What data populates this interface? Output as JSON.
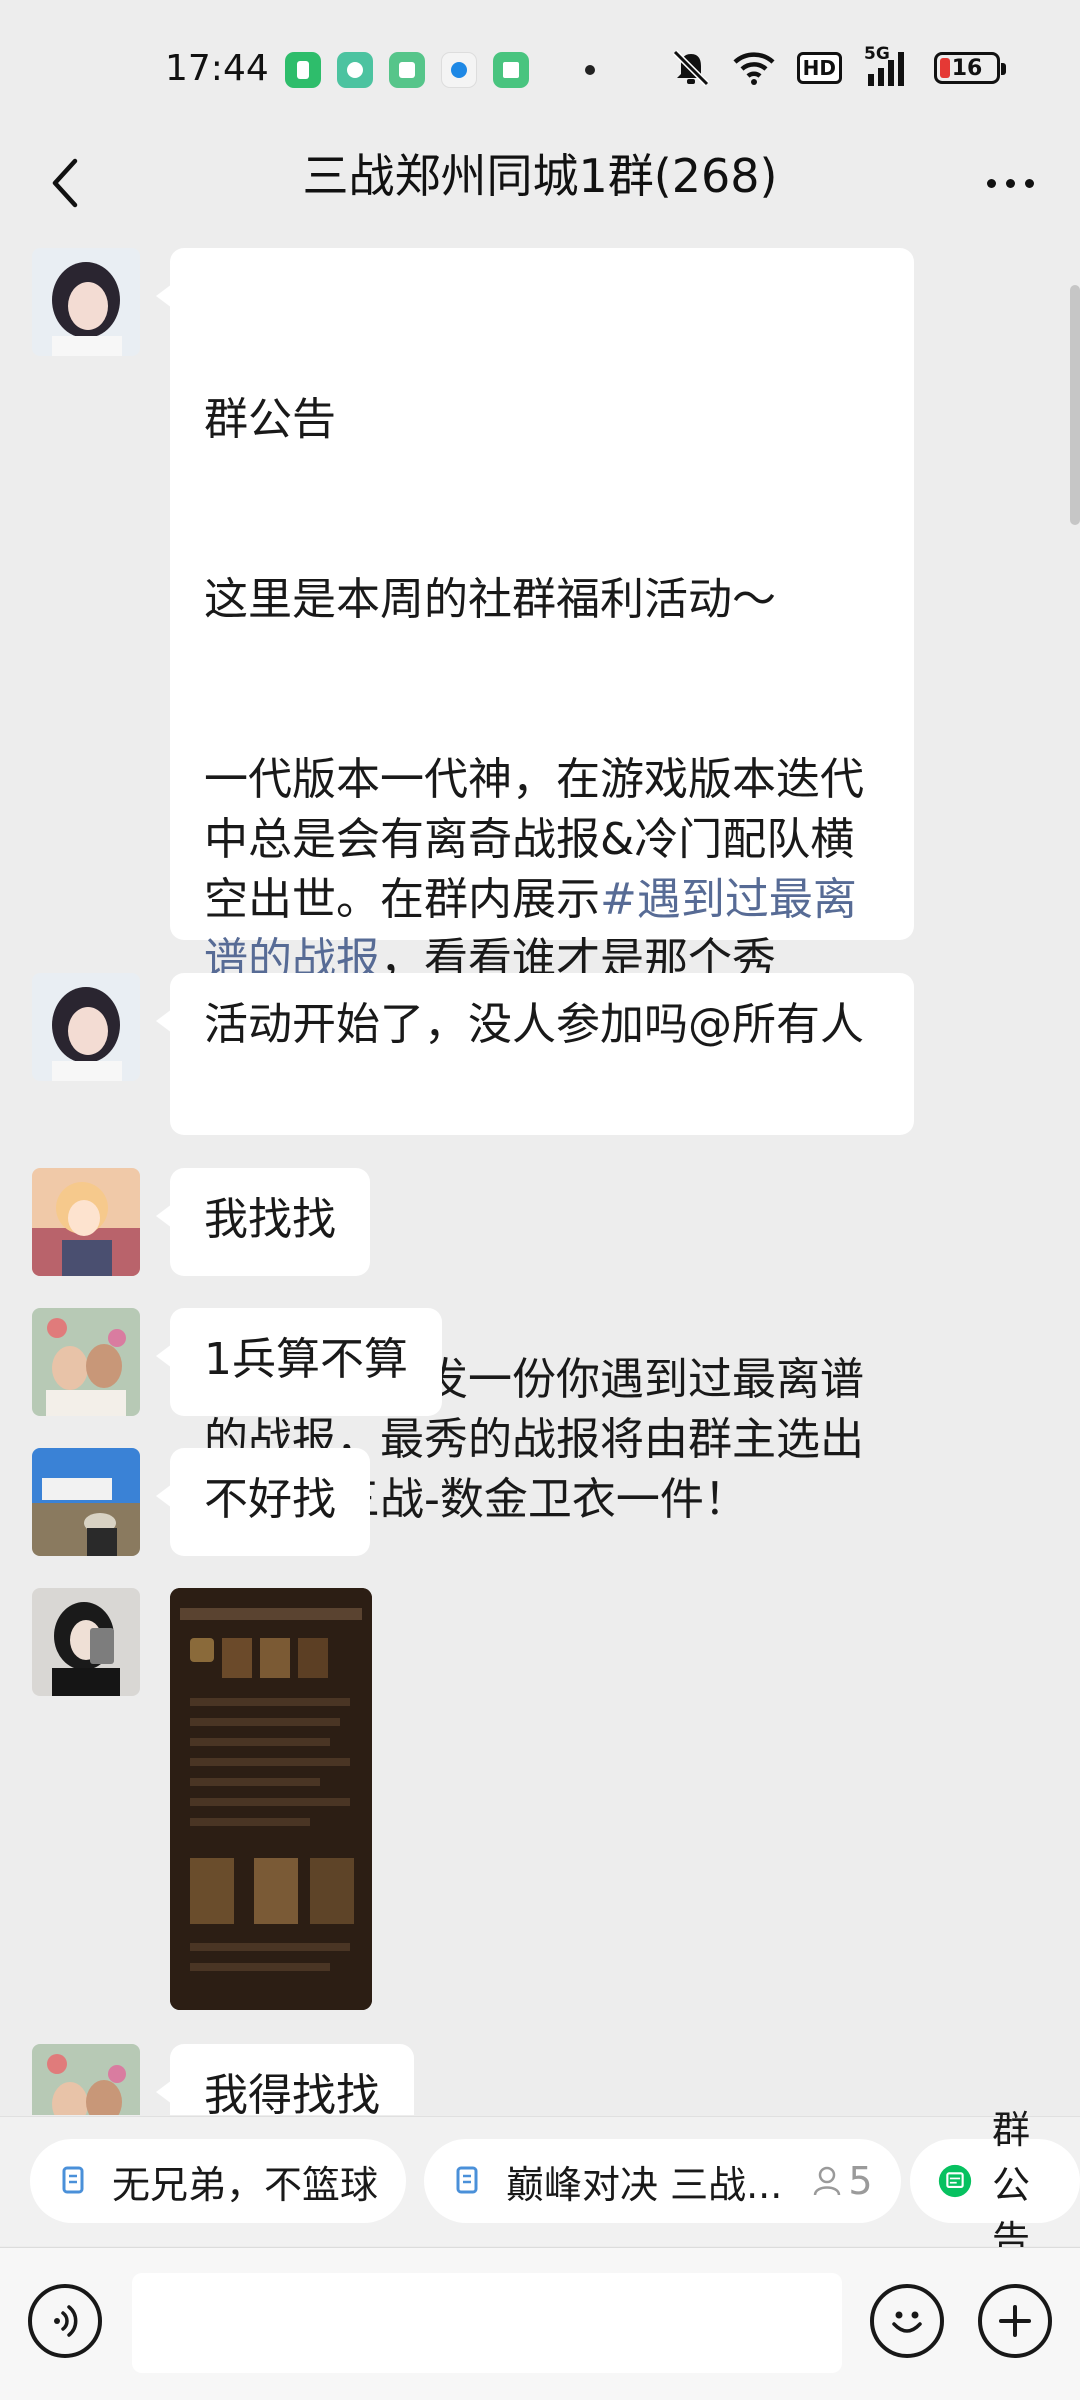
{
  "status_bar": {
    "time": "17:44",
    "network": "5G",
    "hd": "HD",
    "battery": "16",
    "app_icons": [
      "green-app-icon",
      "teal-app-icon",
      "green-square-app-icon",
      "blue-circle-app-icon",
      "green-notes-app-icon"
    ]
  },
  "nav": {
    "title": "三战郑州同城1群(268)"
  },
  "messages": [
    {
      "type": "announcement",
      "avatar": "avatar-girl",
      "title": "群公告",
      "line1": "这里是本周的社群福利活动～",
      "body_pre": "一代版本一代神，在游戏版本迭代\n中总是会有离奇战报&冷门配队横\n空出世。在群内展示",
      "link": "#遇到过最离\n谱的战报",
      "body_post": "，看看谁才是那个秀\n儿！",
      "rules": "活动规则：发一份你遇到过最离谱\n的战报，最秀的战报将由群主选出\n并获得三战-数金卫衣一件！"
    },
    {
      "type": "text",
      "avatar": "avatar-girl",
      "text": "活动开始了，没人参加吗@所有人\n"
    },
    {
      "type": "text",
      "avatar": "avatar-anime",
      "text": "我找找"
    },
    {
      "type": "text",
      "avatar": "avatar-couple",
      "text": "1兵算不算"
    },
    {
      "type": "text",
      "avatar": "avatar-landscape",
      "text": "不好找"
    },
    {
      "type": "image",
      "avatar": "avatar-dark-hair",
      "image": "game-battle-report-screenshot"
    },
    {
      "type": "text",
      "avatar": "avatar-couple",
      "text": "我得找找"
    }
  ],
  "chips": [
    {
      "label": "无兄弟，不篮球",
      "icon": "doc-icon"
    },
    {
      "label": "巅峰对决 三战...",
      "icon": "doc-icon",
      "count": "5"
    },
    {
      "label": "群公告",
      "icon": "announcement-icon"
    }
  ],
  "colors": {
    "background": "#ededed",
    "bubble": "#ffffff",
    "link": "#576b95"
  }
}
